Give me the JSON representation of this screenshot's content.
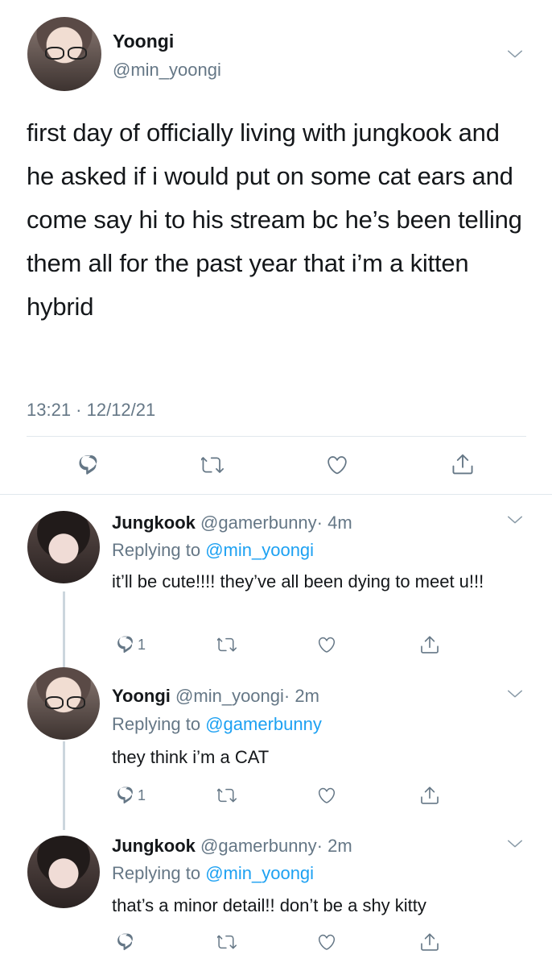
{
  "main_tweet": {
    "author_name": "Yoongi",
    "author_handle": "@min_yoongi",
    "text": "first day of officially living with jungkook and he asked if i would put on some cat ears and come say hi to his stream bc he’s been telling them all for the past year that i’m a kitten hybrid",
    "timestamp": "13:21 · 12/12/21"
  },
  "replies": [
    {
      "author_name": "Jungkook",
      "author_handle": "@gamerbunny",
      "time_ago": "· 4m",
      "replying_prefix": "Replying to",
      "replying_to": "@min_yoongi",
      "text": "it’ll be cute!!!! they’ve all been dying to meet u!!!",
      "reply_count": "1"
    },
    {
      "author_name": "Yoongi",
      "author_handle": "@min_yoongi",
      "time_ago": "· 2m",
      "replying_prefix": "Replying to",
      "replying_to": "@gamerbunny",
      "text": "they think i’m a CAT",
      "reply_count": "1"
    },
    {
      "author_name": "Jungkook",
      "author_handle": "@gamerbunny",
      "time_ago": "· 2m",
      "replying_prefix": "Replying to",
      "replying_to": "@min_yoongi",
      "text": "that’s a minor detail!! don’t be a shy kitty",
      "reply_count": ""
    }
  ],
  "icons": {
    "reply": "reply-icon",
    "retweet": "retweet-icon",
    "like": "heart-icon",
    "share": "share-icon",
    "more": "chevron-down-icon"
  },
  "colors": {
    "link": "#1da1f2",
    "secondary_text": "#657786",
    "icon": "#657786",
    "divider": "#e1e8ed"
  }
}
